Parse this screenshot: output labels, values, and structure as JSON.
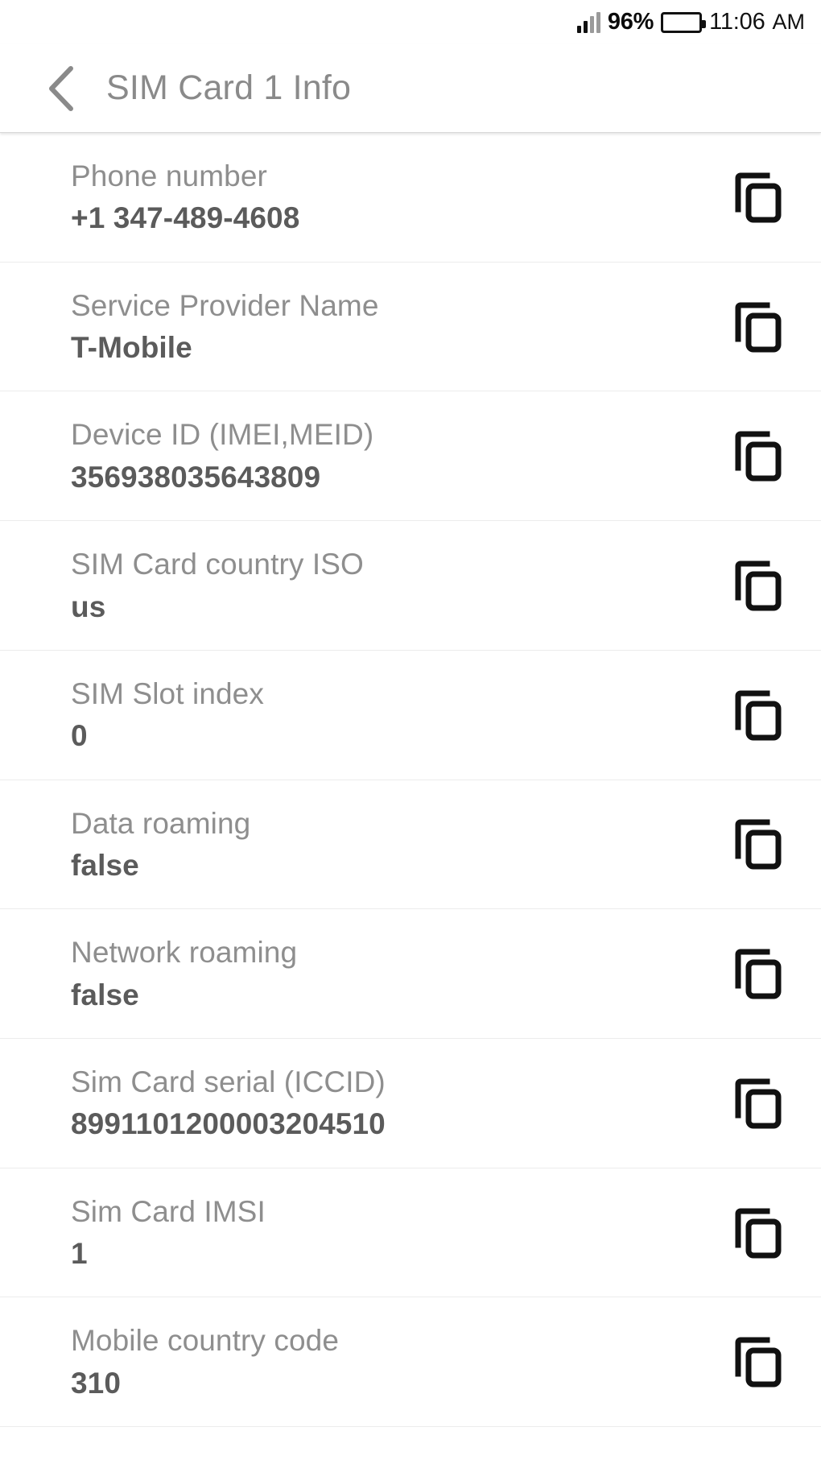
{
  "status_bar": {
    "signal_icon": "signal-bars-icon",
    "battery_percent": "96%",
    "battery_icon": "battery-full-icon",
    "time": "11:06",
    "meridiem": "AM"
  },
  "app_bar": {
    "back_icon": "chevron-left-icon",
    "title": "SIM Card 1 Info"
  },
  "copy_icon_name": "copy-icon",
  "rows": [
    {
      "label": "Phone number",
      "value": "+1 347-489-4608"
    },
    {
      "label": "Service Provider Name",
      "value": "T-Mobile"
    },
    {
      "label": "Device ID (IMEI,MEID)",
      "value": "356938035643809"
    },
    {
      "label": "SIM Card country ISO",
      "value": "us"
    },
    {
      "label": "SIM Slot index",
      "value": "0"
    },
    {
      "label": "Data roaming",
      "value": "false"
    },
    {
      "label": "Network roaming",
      "value": "false"
    },
    {
      "label": "Sim Card serial (ICCID)",
      "value": "8991101200003204510"
    },
    {
      "label": "Sim Card IMSI",
      "value": "1"
    },
    {
      "label": "Mobile country code",
      "value": "310"
    }
  ],
  "colors": {
    "label": "#8e8e8e",
    "value": "#5b5b5b",
    "title": "#8a8a8a",
    "divider": "#ececec",
    "background": "#ffffff",
    "icon": "#111111"
  }
}
